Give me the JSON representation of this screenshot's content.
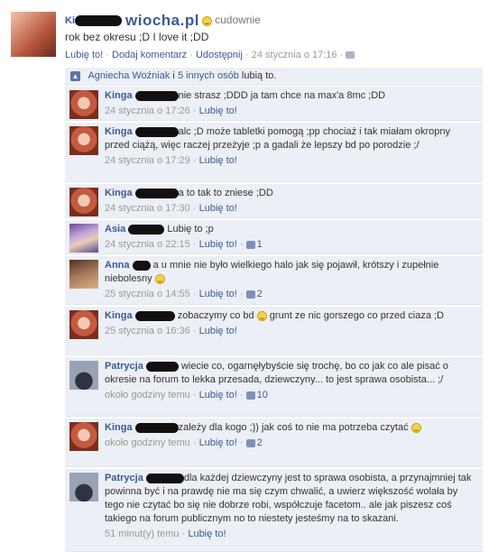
{
  "post": {
    "author": "Ki",
    "watermark": "wiocha.pl",
    "status_word": "cudownie",
    "text": "rok bez okresu ;D I love it ;DD",
    "actions": {
      "like": "Lubię to!",
      "comment": "Dodaj komentarz",
      "share": "Udostępnij",
      "time": "24 stycznia o 17:16"
    }
  },
  "likes_bar": {
    "name": "Agniecha Woźniak",
    "joiner": "i",
    "others": "5 innych osób",
    "suffix": "lubią to."
  },
  "comments": [
    {
      "author": "Kinga",
      "text": "nie strasz ;DDD ja tam chce na max'a 8mc ;DD",
      "time": "24 stycznia o 17:26",
      "like": "Lubię to!",
      "likes": ""
    },
    {
      "author": "Kinga",
      "text": "alc ;D może tabletki pomogą ;pp chociaż i tak miałam okropny przed ciążą, więc raczej przeżyje ;p a gadali że lepszy bd po porodzie ;/",
      "time": "24 stycznia o 17:29",
      "like": "Lubię to!",
      "likes": ""
    },
    {
      "author": "Kinga",
      "text": "a to tak to zniese ;DD",
      "time": "24 stycznia o 17:30",
      "like": "Lubię to!",
      "likes": ""
    },
    {
      "author": "Asia",
      "text": "Lubię to ;p",
      "time": "24 stycznia o 22:15",
      "like": "Lubię to!",
      "likes": "1"
    },
    {
      "author": "Anna",
      "text": "a u mnie nie było wielkiego halo jak się pojawił, krótszy i zupełnie niebolesny",
      "time": "25 stycznia o 14:55",
      "like": "Lubię to!",
      "likes": "2"
    },
    {
      "author": "Kinga",
      "text": "zobaczymy co bd",
      "text2": "grunt ze nic gorszego co przed ciaza ;D",
      "time": "25 stycznia o 16:36",
      "like": "Lubię to!",
      "likes": ""
    },
    {
      "author": "Patrycja",
      "text": "wiecie co, ogarnęłybyście się trochę, bo co jak co ale pisać o okresie na forum to lekka przesada, dziewczyny... to jest sprawa osobista... ;/",
      "time": "około godziny temu",
      "like": "Lubię to!",
      "likes": "10"
    },
    {
      "author": "Kinga",
      "text": "zależy dla kogo ;)) jak coś to nie ma potrzeba czytać",
      "time": "około godziny temu",
      "like": "Lubię to!",
      "likes": "2"
    },
    {
      "author": "Patrycja",
      "text": "dla każdej dziewczyny jest to sprawa osobista, a przynajmniej tak powinna być i na prawdę nie ma się czym chwalić, a uwierz większość wolała by tego nie czytać bo się nie dobrze robi, współczuje facetom.. ale jak piszesz coś takiego na forum publicznym no to niestety jesteśmy na to skazani.",
      "time": "51 minut(y) temu",
      "like": "Lubię to!",
      "likes": ""
    }
  ],
  "separator": "·"
}
